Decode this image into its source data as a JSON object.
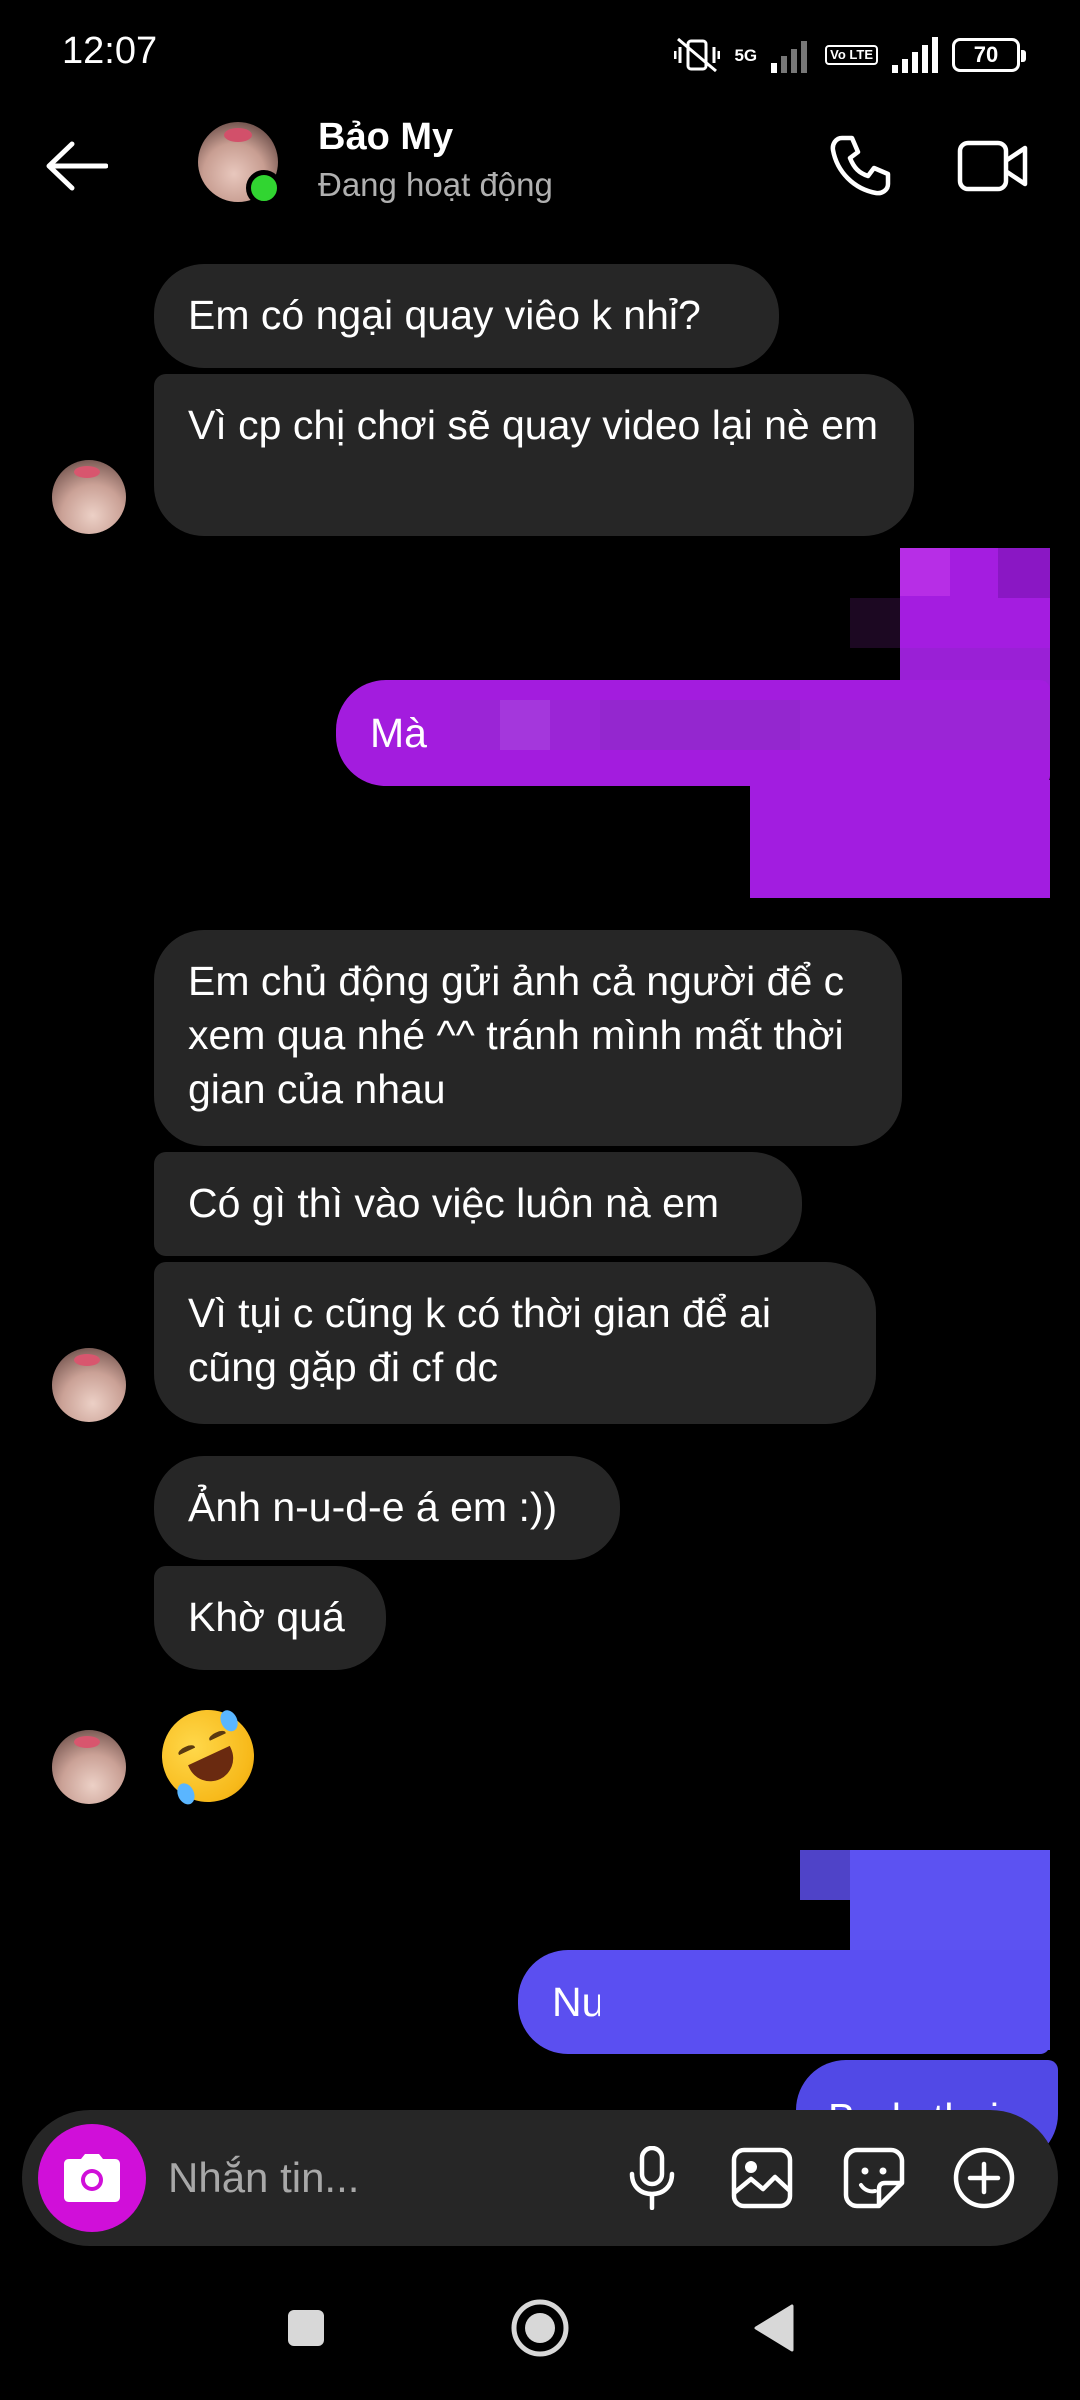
{
  "status_bar": {
    "time": "12:07",
    "network": "5G",
    "volte": "Vo LTE",
    "battery": "70"
  },
  "header": {
    "contact_name": "Bảo My",
    "contact_status": "Đang hoạt động"
  },
  "messages": {
    "m1": "Em có ngại quay viêo k nhỉ?",
    "m2": "Vì cp chị chơi sẽ quay video lại nè em",
    "s1": "Mà",
    "m3": "Em chủ động gửi ảnh cả người để c xem qua nhé ^^ tránh mình mất thời gian của nhau",
    "m4": "Có gì thì vào việc luôn nà em",
    "m5": "Vì tụi c cũng k có thời gian để ai cũng gặp đi cf dc",
    "m6": "Ảnh n-u-d-e á em :))",
    "m7": "Khờ quá",
    "s2": "Nu",
    "s3": "Body thui"
  },
  "composer": {
    "placeholder": "Nhắn tin..."
  },
  "colors": {
    "received_bubble": "#262626",
    "sent_purple": "#a31cde",
    "sent_blue": "#5b4ff0",
    "camera_button": "#d00fd9",
    "online": "#31d531"
  }
}
